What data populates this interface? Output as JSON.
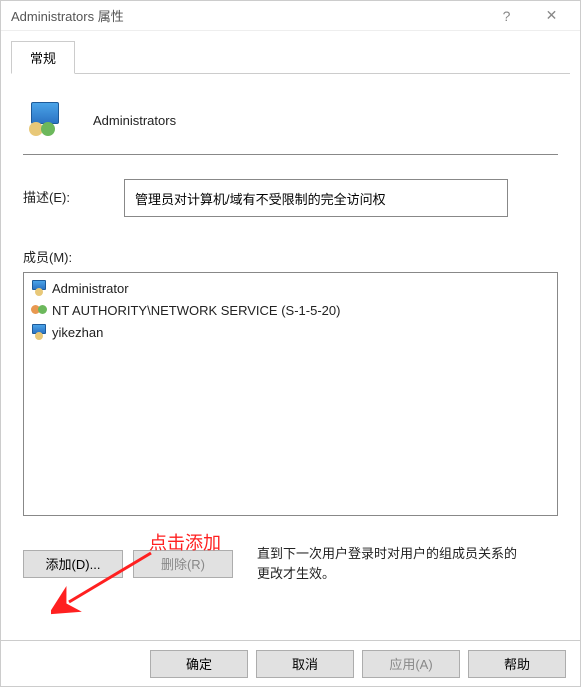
{
  "titlebar": {
    "title": "Administrators 属性"
  },
  "tabs": {
    "general": "常规"
  },
  "group": {
    "name": "Administrators"
  },
  "description": {
    "label": "描述(E):",
    "value": "管理员对计算机/域有不受限制的完全访问权"
  },
  "members": {
    "label": "成员(M):",
    "items": [
      {
        "name": "Administrator",
        "iconType": "user"
      },
      {
        "name": "NT AUTHORITY\\NETWORK SERVICE (S-1-5-20)",
        "iconType": "twohead"
      },
      {
        "name": "yikezhan",
        "iconType": "user"
      }
    ]
  },
  "buttons": {
    "add": "添加(D)...",
    "remove": "删除(R)",
    "ok": "确定",
    "cancel": "取消",
    "apply": "应用(A)",
    "help": "帮助"
  },
  "note": "直到下一次用户登录时对用户的组成员关系的更改才生效。",
  "annotation": {
    "text": "点击添加"
  }
}
